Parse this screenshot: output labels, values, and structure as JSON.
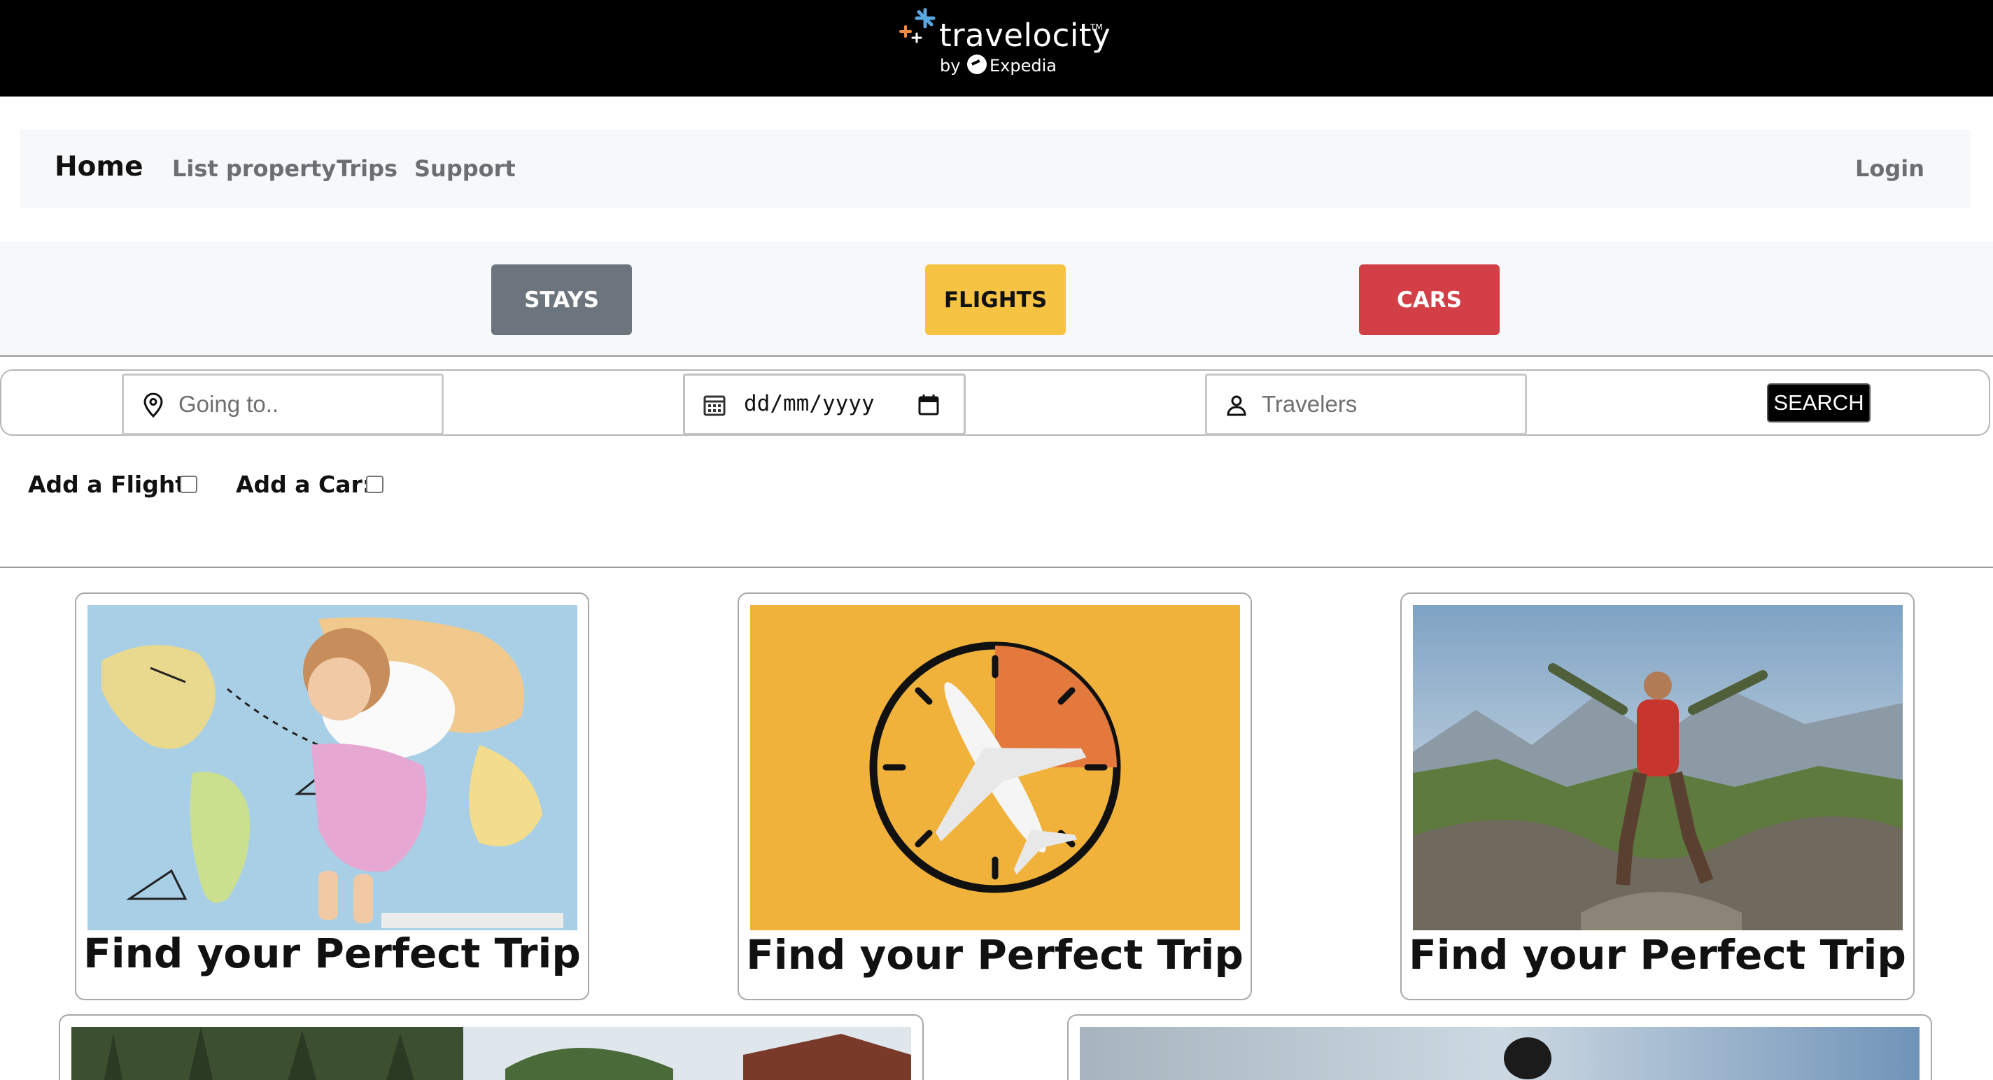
{
  "brand": {
    "name": "travelocity",
    "by": "by",
    "parent": "Expedia",
    "colors": {
      "bar": "#000000",
      "star_blue": "#5aa7e0",
      "star_orange": "#f08a3c"
    }
  },
  "nav": {
    "home": "Home",
    "links": [
      "List property",
      "Trips",
      "Support"
    ],
    "login": "Login"
  },
  "categories": {
    "stays": {
      "label": "STAYS",
      "color": "#6c757d"
    },
    "flights": {
      "label": "FLIGHTS",
      "color": "#f6c342"
    },
    "cars": {
      "label": "CARS",
      "color": "#d23f47"
    }
  },
  "search": {
    "destination_placeholder": "Going to..",
    "date_placeholder": "dd/mm/yyyy",
    "travelers_placeholder": "Travelers",
    "button": "SEARCH",
    "icons": [
      "map-pin-icon",
      "calendar-icon",
      "person-icon"
    ]
  },
  "addons": {
    "flight_label": "Add a Flight:",
    "flight_checked": false,
    "car_label": "Add a Car:",
    "car_checked": false
  },
  "cards": [
    {
      "title": "Find your Perfect Trip",
      "image": "girl-drawing-on-world-map"
    },
    {
      "title": "Find your Perfect Trip",
      "image": "airplane-clock-yellow"
    },
    {
      "title": "Find your Perfect Trip",
      "image": "hiker-mountains"
    },
    {
      "title": "",
      "image": "palm-trees-resort"
    },
    {
      "title": "",
      "image": "cyclist-sky"
    }
  ]
}
